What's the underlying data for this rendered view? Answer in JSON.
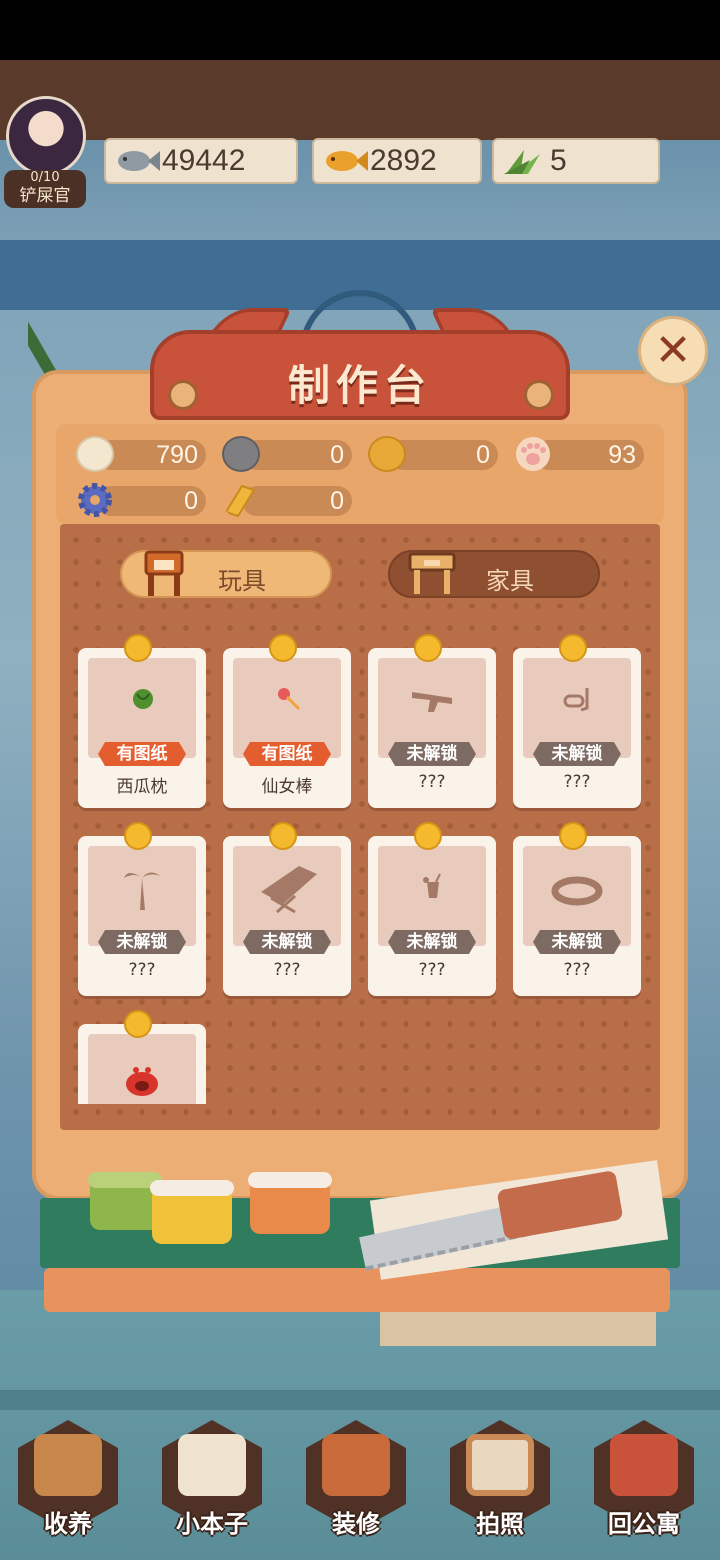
{
  "top_bar": {
    "avatar": {
      "count": "0/10",
      "role": "铲屎官"
    },
    "resources": [
      {
        "icon": "gray-fish-icon",
        "value": "49442",
        "color": "#8f9aa3"
      },
      {
        "icon": "gold-fish-icon",
        "value": "2892",
        "color": "#e9a12c"
      },
      {
        "icon": "grass-icon",
        "value": "5",
        "color": "#5f9a3c"
      }
    ]
  },
  "crafting_table": {
    "title": "制作台",
    "close_icon": "close-icon",
    "materials": [
      {
        "icon": "cotton-icon",
        "value": "790",
        "color": "#f3e7cf"
      },
      {
        "icon": "stone-icon",
        "value": "0",
        "color": "#7f7f82"
      },
      {
        "icon": "bread-icon",
        "value": "0",
        "color": "#e9a938"
      },
      {
        "icon": "paw-icon",
        "value": "93",
        "color": "#f6d7c0"
      },
      {
        "icon": "gear-icon",
        "value": "0",
        "color": "#5b6bc0"
      },
      {
        "icon": "gold-bar-icon",
        "value": "0",
        "color": "#f0b53b"
      }
    ],
    "tabs": [
      {
        "label": "玩具",
        "icon": "stool-icon",
        "active": true
      },
      {
        "label": "家具",
        "icon": "desk-icon",
        "active": false
      }
    ],
    "items": [
      {
        "name": "西瓜枕",
        "status": "有图纸",
        "icon": "watermelon-icon",
        "unlocked": true
      },
      {
        "name": "仙女棒",
        "status": "有图纸",
        "icon": "wand-icon",
        "unlocked": true
      },
      {
        "name": "???",
        "status": "未解锁",
        "icon": "water-gun-icon",
        "unlocked": false
      },
      {
        "name": "???",
        "status": "未解锁",
        "icon": "snorkel-icon",
        "unlocked": false
      },
      {
        "name": "???",
        "status": "未解锁",
        "icon": "palm-tree-icon",
        "unlocked": false
      },
      {
        "name": "???",
        "status": "未解锁",
        "icon": "beach-chair-icon",
        "unlocked": false
      },
      {
        "name": "???",
        "status": "未解锁",
        "icon": "drink-icon",
        "unlocked": false
      },
      {
        "name": "???",
        "status": "未解锁",
        "icon": "swim-ring-icon",
        "unlocked": false
      },
      {
        "name": "",
        "status": "",
        "icon": "crab-icon",
        "unlocked": false
      }
    ]
  },
  "bottom_nav": [
    {
      "label": "收养",
      "icon": "adopt-box-icon"
    },
    {
      "label": "小本子",
      "icon": "notebook-icon"
    },
    {
      "label": "装修",
      "icon": "decorate-brush-icon"
    },
    {
      "label": "拍照",
      "icon": "camera-icon"
    },
    {
      "label": "回公寓",
      "icon": "apartment-icon"
    }
  ]
}
